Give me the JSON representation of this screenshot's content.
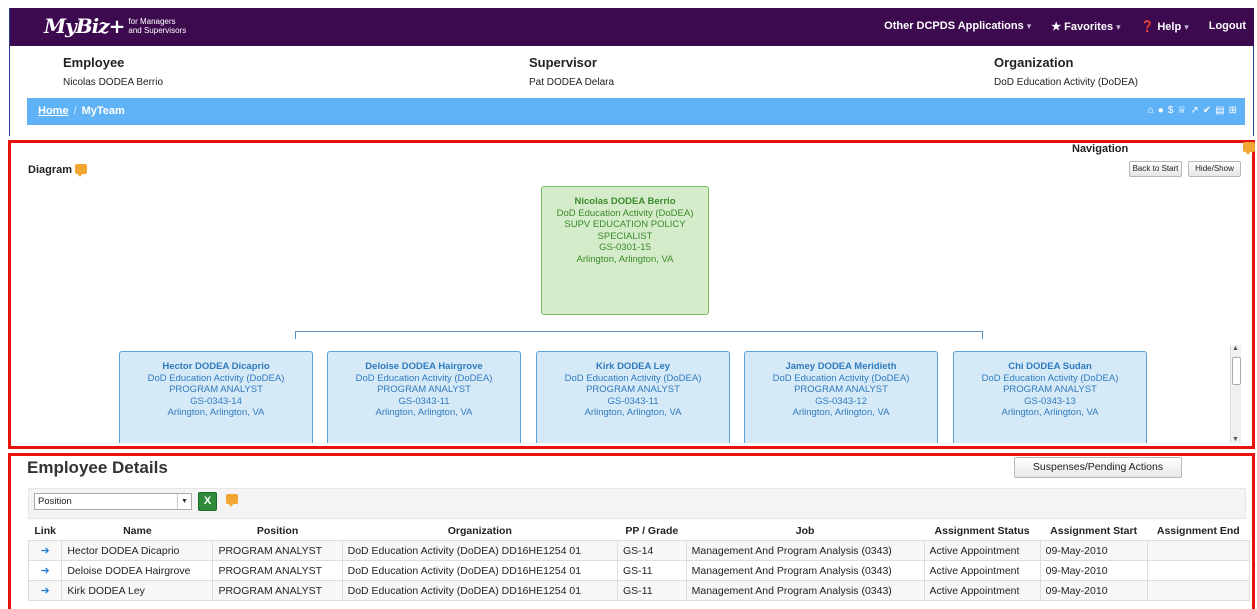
{
  "header": {
    "logo_mark": "MyBiz+",
    "logo_sub_1": "for Managers",
    "logo_sub_2": "and Supervisors",
    "nav": [
      {
        "label": "Other DCPDS Applications",
        "caret": "▾"
      },
      {
        "label": "★ Favorites",
        "caret": "▾"
      },
      {
        "label": "❓ Help",
        "caret": "▾"
      },
      {
        "label": "Logout",
        "caret": ""
      }
    ]
  },
  "info": {
    "employee_label": "Employee",
    "employee_value": "Nicolas DODEA Berrio",
    "supervisor_label": "Supervisor",
    "supervisor_value": "Pat DODEA Delara",
    "organization_label": "Organization",
    "organization_value": "DoD Education Activity (DoDEA)"
  },
  "breadcrumb": {
    "home": "Home",
    "separator": "/",
    "current": "MyTeam"
  },
  "toolbar_icons": [
    "home-icon",
    "user-icon",
    "dollar-icon",
    "graduation-icon",
    "trend-icon",
    "thumbs-up-icon",
    "document-icon",
    "org-chart-icon"
  ],
  "diagram": {
    "title": "Diagram",
    "navigation_title": "Navigation",
    "back_to_start": "Back to Start",
    "hide_show": "Hide/Show",
    "root": {
      "name": "Nicolas DODEA Berrio",
      "org": "DoD Education Activity (DoDEA)",
      "title_1": "SUPV EDUCATION POLICY",
      "title_2": "SPECIALIST",
      "grade": "GS-0301-15",
      "location": "Arlington, Arlington, VA"
    },
    "children": [
      {
        "name": "Hector DODEA Dicaprio",
        "org": "DoD Education Activity (DoDEA)",
        "title": "PROGRAM ANALYST",
        "grade": "GS-0343-14",
        "location": "Arlington, Arlington, VA"
      },
      {
        "name": "Deloise DODEA Hairgrove",
        "org": "DoD Education Activity (DoDEA)",
        "title": "PROGRAM ANALYST",
        "grade": "GS-0343-11",
        "location": "Arlington, Arlington, VA"
      },
      {
        "name": "Kirk DODEA Ley",
        "org": "DoD Education Activity (DoDEA)",
        "title": "PROGRAM ANALYST",
        "grade": "GS-0343-11",
        "location": "Arlington, Arlington, VA"
      },
      {
        "name": "Jamey DODEA Meridieth",
        "org": "DoD Education Activity (DoDEA)",
        "title": "PROGRAM ANALYST",
        "grade": "GS-0343-12",
        "location": "Arlington, Arlington, VA"
      },
      {
        "name": "Chi DODEA Sudan",
        "org": "DoD Education Activity (DoDEA)",
        "title": "PROGRAM ANALYST",
        "grade": "GS-0343-13",
        "location": "Arlington, Arlington, VA"
      }
    ]
  },
  "details": {
    "title": "Employee Details",
    "suspenses_button": "Suspenses/Pending Actions",
    "filter_selected": "Position",
    "excel_label": "X",
    "columns": [
      "Link",
      "Name",
      "Position",
      "Organization",
      "PP / Grade",
      "Job",
      "Assignment Status",
      "Assignment Start",
      "Assignment End"
    ],
    "rows": [
      {
        "name": "Hector DODEA Dicaprio",
        "position": "PROGRAM ANALYST",
        "organization": "DoD Education Activity (DoDEA) DD16HE1254 01",
        "grade": "GS-14",
        "job": "Management And Program Analysis (0343)",
        "status": "Active Appointment",
        "start": "09-May-2010",
        "end": ""
      },
      {
        "name": "Deloise DODEA Hairgrove",
        "position": "PROGRAM ANALYST",
        "organization": "DoD Education Activity (DoDEA) DD16HE1254 01",
        "grade": "GS-11",
        "job": "Management And Program Analysis (0343)",
        "status": "Active Appointment",
        "start": "09-May-2010",
        "end": ""
      },
      {
        "name": "Kirk DODEA Ley",
        "position": "PROGRAM ANALYST",
        "organization": "DoD Education Activity (DoDEA) DD16HE1254 01",
        "grade": "GS-11",
        "job": "Management And Program Analysis (0343)",
        "status": "Active Appointment",
        "start": "09-May-2010",
        "end": ""
      }
    ]
  }
}
